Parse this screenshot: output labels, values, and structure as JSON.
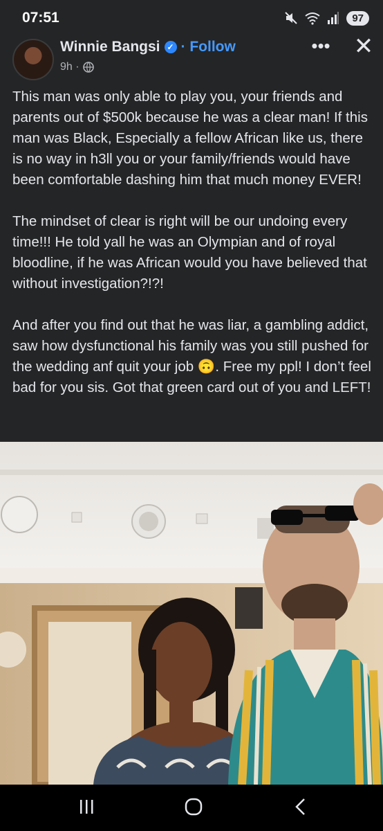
{
  "status": {
    "time": "07:51",
    "battery": "97",
    "icons": [
      "mute-icon",
      "wifi-icon",
      "signal-icon"
    ]
  },
  "post": {
    "author": "Winnie Bangsi",
    "follow_label": "· Follow",
    "time_ago": "9h ·",
    "paragraphs": [
      "This man was only able to play you, your friends and parents out of $500k because he was a clear man! If this man was Black, Especially a fellow African like us, there is no way in h3ll you or your family/friends would have been comfortable dashing him that much money EVER!",
      "The mindset of clear is right will be our undoing every time!!! He told yall he was an Olympian and of royal bloodline, if he was African would you have believed that without investigation?!?!",
      "And after you find out that he was liar, a gambling addict, saw how dysfunctional his family was you still pushed for the wedding anf quit your job 🙃. Free my ppl! I don’t feel bad for you sis. Got that green card out of you and LEFT!"
    ]
  },
  "colors": {
    "background": "#242526",
    "text": "#e4e6eb",
    "link": "#4599ff",
    "verified": "#2d88ff",
    "navbar": "#000000"
  },
  "navigation": {
    "icons": [
      "recent-apps-icon",
      "home-icon",
      "back-icon"
    ]
  }
}
